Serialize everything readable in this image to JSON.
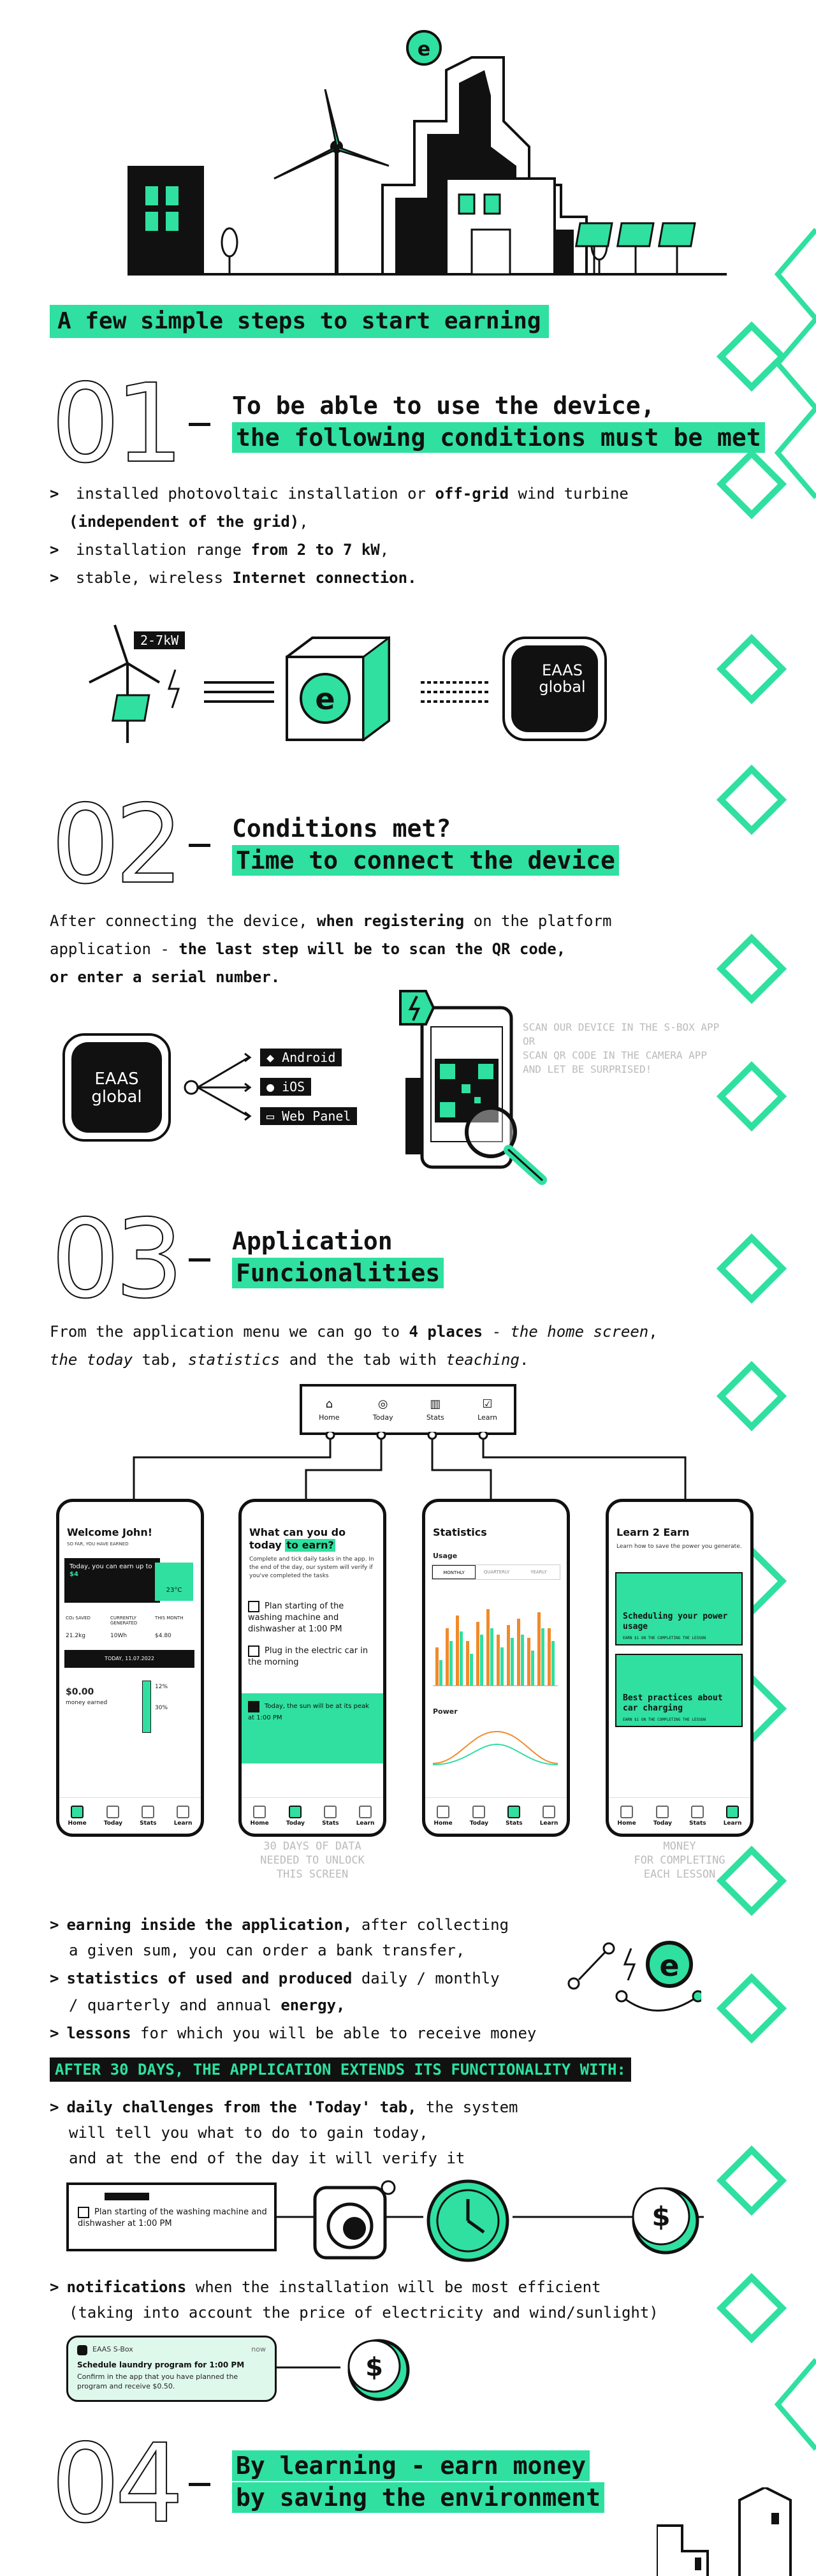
{
  "banner": {
    "title": "A few simple steps to start earning"
  },
  "step1": {
    "number": "01",
    "heading_line1": "To be able to use the device,",
    "heading_line2": "the following conditions must be met",
    "bullets": [
      {
        "text_a": "installed photovoltaic installation or ",
        "bold_a": "off-grid",
        "text_b": " wind turbine",
        "line2_bold": "(independent of the grid)",
        "line2_text": ","
      },
      {
        "text_a": "installation range ",
        "bold_a": "from 2 to 7 kW",
        "text_b": ","
      },
      {
        "text_a": "stable, wireless ",
        "bold_a": "Internet connection.",
        "text_b": ""
      }
    ],
    "power_tag": "2-7kW",
    "brand_line1": "EAAS",
    "brand_line2": "global"
  },
  "step2": {
    "number": "02",
    "heading_line1": "Conditions met?",
    "heading_line2": "Time to connect the device",
    "para_line1_a": "After connecting the device, ",
    "para_line1_b": "when registering",
    "para_line1_c": " on the platform",
    "para_line2_a": "application - ",
    "para_line2_b": "the last step will be to scan the QR code,",
    "para_line3": "or enter a serial number.",
    "platforms": [
      "Android",
      "iOS",
      "Web Panel"
    ],
    "scan_hint": [
      "SCAN OUR DEVICE IN THE S-BOX APP",
      "OR",
      "SCAN QR CODE IN THE CAMERA APP",
      "AND LET BE SURPRISED!"
    ],
    "brand_line1": "EAAS",
    "brand_line2": "global"
  },
  "step3": {
    "number": "03",
    "heading_line1": "Application",
    "heading_line2": "Funcionalities",
    "para_a": "From the application menu we can go to ",
    "para_b": "4 places",
    "para_c": " - ",
    "para_d": "the home screen",
    "para_e": ",",
    "para2_a": "the today",
    "para2_b": " tab, ",
    "para2_c": "statistics",
    "para2_d": " and the tab with ",
    "para2_e": "teaching",
    "para2_f": ".",
    "menu": [
      "Home",
      "Today",
      "Stats",
      "Learn"
    ],
    "phones": {
      "home": {
        "greeting": "Welcome John!",
        "earned_label": "SO FAR, YOU HAVE EARNED",
        "today_text": "Today, you can earn up to",
        "today_value": "$4",
        "temp": "23°C",
        "stats": [
          "CO₂ SAVED",
          "CURRENTLY GENERATED",
          "THIS MONTH"
        ],
        "stat_values": [
          "21.2kg",
          "10Wh",
          "$4.80"
        ],
        "money": "$0.00",
        "money_label": "money earned",
        "date": "TODAY, 11.07.2022",
        "percent_a": "12%",
        "percent_b": "30%"
      },
      "today": {
        "title_a": "What can you do",
        "title_b": "today ",
        "title_hl": "to earn?",
        "desc": "Complete and tick daily tasks in the app. In the end of the day, our system will verify if you've completed the tasks",
        "tasks": [
          "Plan starting of the washing machine and dishwasher at 1:00 PM",
          "Plug in the electric car in the morning"
        ],
        "done": "Today, the sun will be at its peak at 1:00 PM"
      },
      "stats": {
        "title": "Statistics",
        "usage": "Usage",
        "tabs": [
          "MONTHLY",
          "QUARTERLY",
          "YEARLY"
        ],
        "power": "Power"
      },
      "learn": {
        "title": "Learn 2 Earn",
        "desc": "Learn how to save the power you generate.",
        "lesson1": "Scheduling your power usage",
        "lesson2": "Best practices about car charging",
        "reward": "EARN $1 ON THE COMPLETING THE LESSON"
      }
    },
    "nav": [
      "Home",
      "Today",
      "Stats",
      "Learn"
    ],
    "caption_today": [
      "30 DAYS OF DATA",
      "NEEDED TO UNLOCK",
      "THIS SCREEN"
    ],
    "caption_learn": [
      "MONEY",
      "FOR COMPLETING",
      "EACH LESSON"
    ],
    "features": [
      {
        "bold": "earning inside the application,",
        "text": " after collecting",
        "line2": "a given sum, you can order a bank transfer,"
      },
      {
        "bold": "statistics of used and produced",
        "text": " daily / monthly",
        "line2": "/ quarterly and annual ",
        "line2_bold": "energy,"
      },
      {
        "bold": "lessons",
        "text": " for which you will be able to receive money"
      }
    ],
    "after_banner": "AFTER 30 DAYS, THE APPLICATION EXTENDS ITS FUNCTIONALITY WITH:",
    "challenges_bold": "daily challenges from the 'Today' tab,",
    "challenges_text": " the system",
    "challenges_line2": "will tell you what to do to gain today,",
    "challenges_line3": "and at the end of the day it will verify it",
    "challenge_task": "Plan starting of the washing machine and dishwasher at 1:00 PM",
    "notif_bold": "notifications",
    "notif_text": " when the installation will be most efficient",
    "notif_line2": "(taking into account the price of electricity and wind/sunlight)",
    "notification": {
      "app": "EAAS S-Box",
      "time": "now",
      "title": "Schedule laundry program for 1:00 PM",
      "body": "Confirm in the app that you have planned the program and receive $0.50."
    }
  },
  "step4": {
    "number": "04",
    "heading_line1": "By learning - earn money",
    "heading_line2": "by saving the environment"
  },
  "colors": {
    "accent": "#2fe0a0",
    "ink": "#111111"
  }
}
